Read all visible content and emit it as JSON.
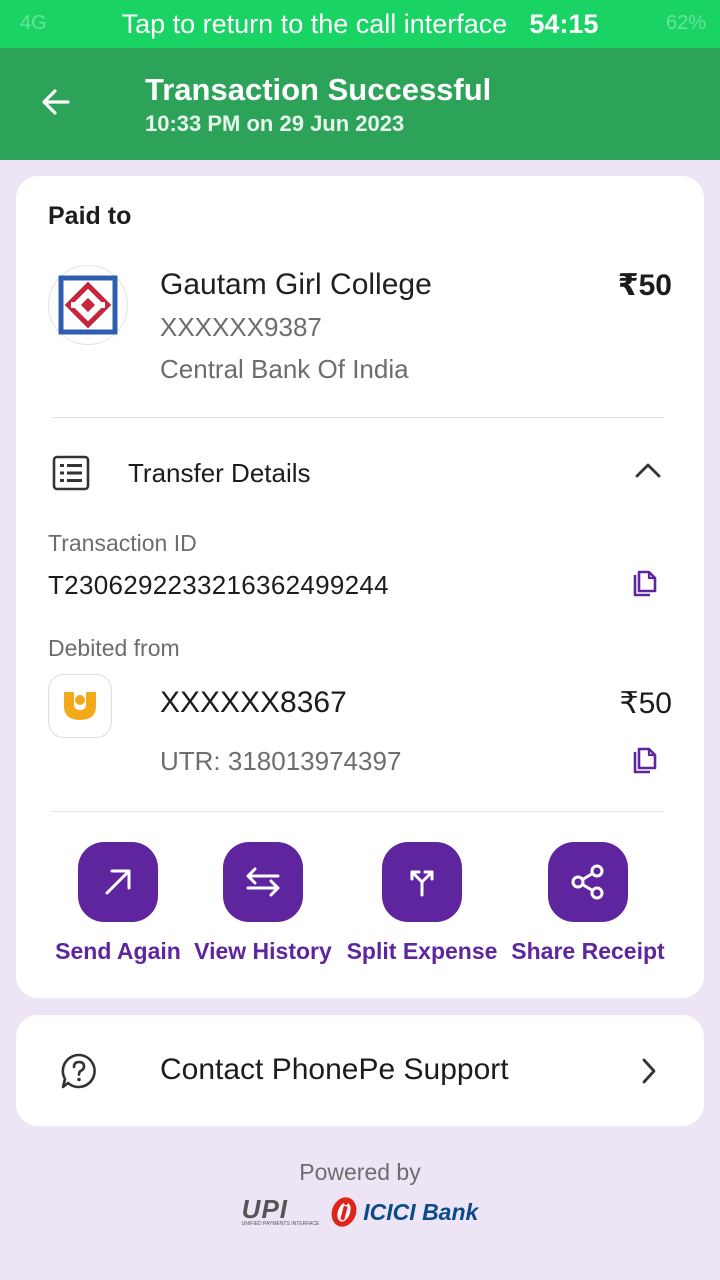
{
  "call_bar": {
    "text": "Tap to return to the call interface",
    "timer": "54:15",
    "network_ghost": "4G",
    "battery_ghost": "62%"
  },
  "header": {
    "title": "Transaction Successful",
    "subtitle": "10:33 PM on 29 Jun 2023",
    "back_icon": "arrow-left-icon"
  },
  "paid_to": {
    "label": "Paid to",
    "name": "Gautam Girl College",
    "account": "XXXXXX9387",
    "bank": "Central Bank Of India",
    "amount": "₹50"
  },
  "transfer_details": {
    "label": "Transfer Details",
    "txn_id_label": "Transaction ID",
    "txn_id": "T2306292233216362499244",
    "debited_label": "Debited from",
    "debited_account": "XXXXXX8367",
    "debited_amount": "₹50",
    "utr": "UTR: 318013974397"
  },
  "actions": [
    {
      "label": "Send Again",
      "icon": "arrow-up-right-icon"
    },
    {
      "label": "View History",
      "icon": "swap-arrows-icon"
    },
    {
      "label": "Split Expense",
      "icon": "split-icon"
    },
    {
      "label": "Share Receipt",
      "icon": "share-icon"
    }
  ],
  "support": {
    "label": "Contact PhonePe Support",
    "icon": "help-chat-icon"
  },
  "footer": {
    "powered_by": "Powered by",
    "upi_logo_text": "UPI",
    "upi_logo_sub": "UNIFIED PAYMENTS INTERFACE",
    "icici_logo_text": "ICICI",
    "icici_logo_bank": "Bank"
  },
  "colors": {
    "accent_purple": "#5f259f",
    "header_green": "#2da35a",
    "call_bar_green": "#19d364",
    "background": "#ede5f5"
  }
}
